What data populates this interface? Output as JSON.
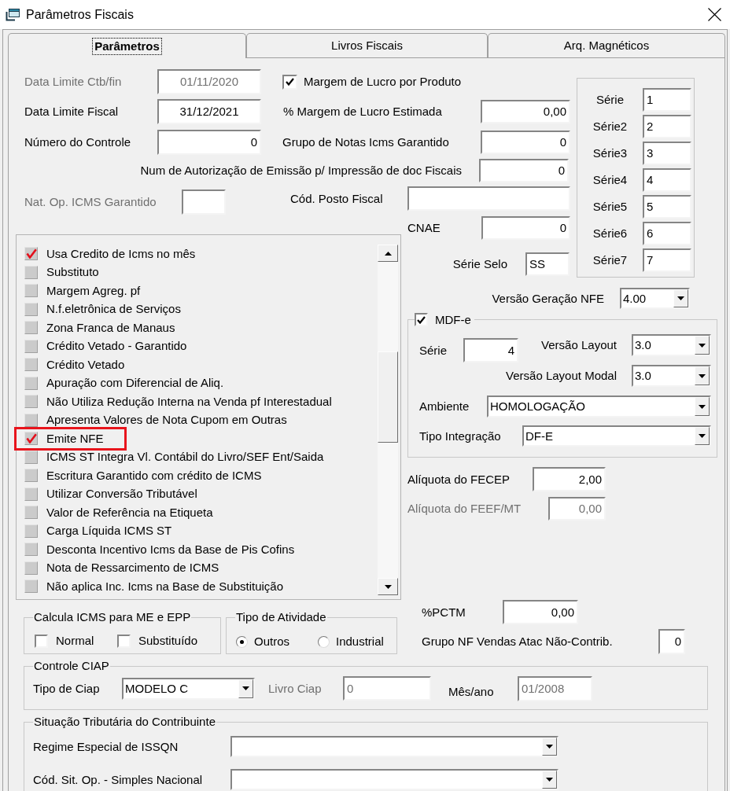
{
  "window": {
    "title": "Parâmetros Fiscais"
  },
  "tabs": [
    {
      "label": "Parâmetros",
      "selected": true
    },
    {
      "label": "Livros Fiscais",
      "selected": false
    },
    {
      "label": "Arq. Magnéticos",
      "selected": false
    }
  ],
  "date_fields": [
    {
      "label": "Data Limite Ctb/fin",
      "value": "01/11/2020",
      "disabled": true
    },
    {
      "label": "Data Limite Fiscal",
      "value": "31/12/2021",
      "disabled": false
    },
    {
      "label": "Número do Controle",
      "value": "0",
      "disabled": false
    }
  ],
  "margem_lucro_por_produto": {
    "label": "Margem de Lucro por Produto",
    "checked": true
  },
  "right_fields": [
    {
      "label": "% Margem de Lucro Estimada",
      "value": "0,00"
    },
    {
      "label": "Grupo de Notas Icms Garantido",
      "value": "0"
    }
  ],
  "num_autorizacao": {
    "label": "Num de Autorização de Emissão p/ Impressão de doc Fiscais",
    "value": "0"
  },
  "nat_op_icms_garantido": {
    "label": "Nat. Op. ICMS Garantido",
    "disabled": true
  },
  "cod_posto_fiscal": {
    "label": "Cód. Posto Fiscal"
  },
  "cnae": {
    "label": "CNAE",
    "value": "0"
  },
  "serie_selo": {
    "label": "Série Selo",
    "value": "SS"
  },
  "series": [
    {
      "label": "Série",
      "value": "1"
    },
    {
      "label": "Série2",
      "value": "2"
    },
    {
      "label": "Série3",
      "value": "3"
    },
    {
      "label": "Série4",
      "value": "4"
    },
    {
      "label": "Série5",
      "value": "5"
    },
    {
      "label": "Série6",
      "value": "6"
    },
    {
      "label": "Série7",
      "value": "7"
    }
  ],
  "options": [
    {
      "label": "Usa Credito de Icms no mês",
      "checked": true,
      "highlighted": false
    },
    {
      "label": "Substituto",
      "checked": false,
      "highlighted": false
    },
    {
      "label": "Margem Agreg. pf",
      "checked": false,
      "highlighted": false
    },
    {
      "label": "N.f.eletrônica de Serviços",
      "checked": false,
      "highlighted": false
    },
    {
      "label": "Zona Franca de Manaus",
      "checked": false,
      "highlighted": false
    },
    {
      "label": "Crédito Vetado - Garantido",
      "checked": false,
      "highlighted": false
    },
    {
      "label": "Crédito Vetado",
      "checked": false,
      "highlighted": false
    },
    {
      "label": "Apuração com Diferencial de Aliq.",
      "checked": false,
      "highlighted": false
    },
    {
      "label": "Não Utiliza Redução Interna na Venda pf Interestadual",
      "checked": false,
      "highlighted": false
    },
    {
      "label": "Apresenta Valores de Nota Cupom em Outras",
      "checked": false,
      "highlighted": false
    },
    {
      "label": "Emite NFE",
      "checked": true,
      "highlighted": true
    },
    {
      "label": "ICMS ST Integra Vl. Contábil do Livro/SEF Ent/Saida",
      "checked": false,
      "highlighted": false
    },
    {
      "label": "Escritura Garantido com crédito de ICMS",
      "checked": false,
      "highlighted": false
    },
    {
      "label": "Utilizar Conversão Tributável",
      "checked": false,
      "highlighted": false
    },
    {
      "label": "Valor de Referência na Etiqueta",
      "checked": false,
      "highlighted": false
    },
    {
      "label": "Carga Líquida ICMS ST",
      "checked": false,
      "highlighted": false
    },
    {
      "label": "Desconta Incentivo Icms da Base de Pis Cofins",
      "checked": false,
      "highlighted": false
    },
    {
      "label": "Nota de Ressarcimento de ICMS",
      "checked": false,
      "highlighted": false
    },
    {
      "label": "Não aplica Inc. Icms na Base de Substituição",
      "checked": false,
      "highlighted": false
    }
  ],
  "versao_geracao_nfe": {
    "label": "Versão Geração NFE",
    "value": "4.00"
  },
  "mdfe": {
    "label": "MDF-e",
    "checked": true,
    "serie": {
      "label": "Série",
      "value": "4"
    },
    "versao_layout": {
      "label": "Versão Layout",
      "value": "3.0"
    },
    "versao_layout_modal": {
      "label": "Versão Layout Modal",
      "value": "3.0"
    },
    "ambiente": {
      "label": "Ambiente",
      "value": "HOMOLOGAÇÃO"
    },
    "tipo_integracao": {
      "label": "Tipo Integração",
      "value": "DF-E"
    }
  },
  "aliquotas": [
    {
      "label": "Alíquota do FECEP",
      "value": "2,00",
      "disabled": false
    },
    {
      "label": "Alíquota do FEEF/MT",
      "value": "0,00",
      "disabled": true
    }
  ],
  "calcula_icms_me_epp": {
    "title": "Calcula ICMS para ME e EPP",
    "options": [
      {
        "label": "Normal",
        "checked": false
      },
      {
        "label": "Substituído",
        "checked": false
      }
    ]
  },
  "tipo_atividade": {
    "title": "Tipo de Atividade",
    "options": [
      {
        "label": "Outros",
        "selected": true
      },
      {
        "label": "Industrial",
        "selected": false
      }
    ]
  },
  "pctm": {
    "label": "%PCTM",
    "value": "0,00"
  },
  "grupo_nf_vendas": {
    "label": "Grupo NF Vendas Atac Não-Contrib.",
    "value": "0"
  },
  "controle_ciap": {
    "title": "Controle CIAP",
    "tipo_ciap": {
      "label": "Tipo de Ciap",
      "value": "MODELO C"
    },
    "livro_ciap": {
      "label": "Livro Ciap",
      "value": "0",
      "disabled": true
    },
    "mes_ano": {
      "label": "Mês/ano",
      "value": "01/2008",
      "disabled": true,
      "label_disabled": false
    }
  },
  "situacao_tributaria": {
    "title": "Situação Tributária do Contribuinte",
    "fields": [
      {
        "label": "Regime Especial de ISSQN"
      },
      {
        "label": "Cód. Sit. Op. - Simples Nacional"
      }
    ]
  }
}
